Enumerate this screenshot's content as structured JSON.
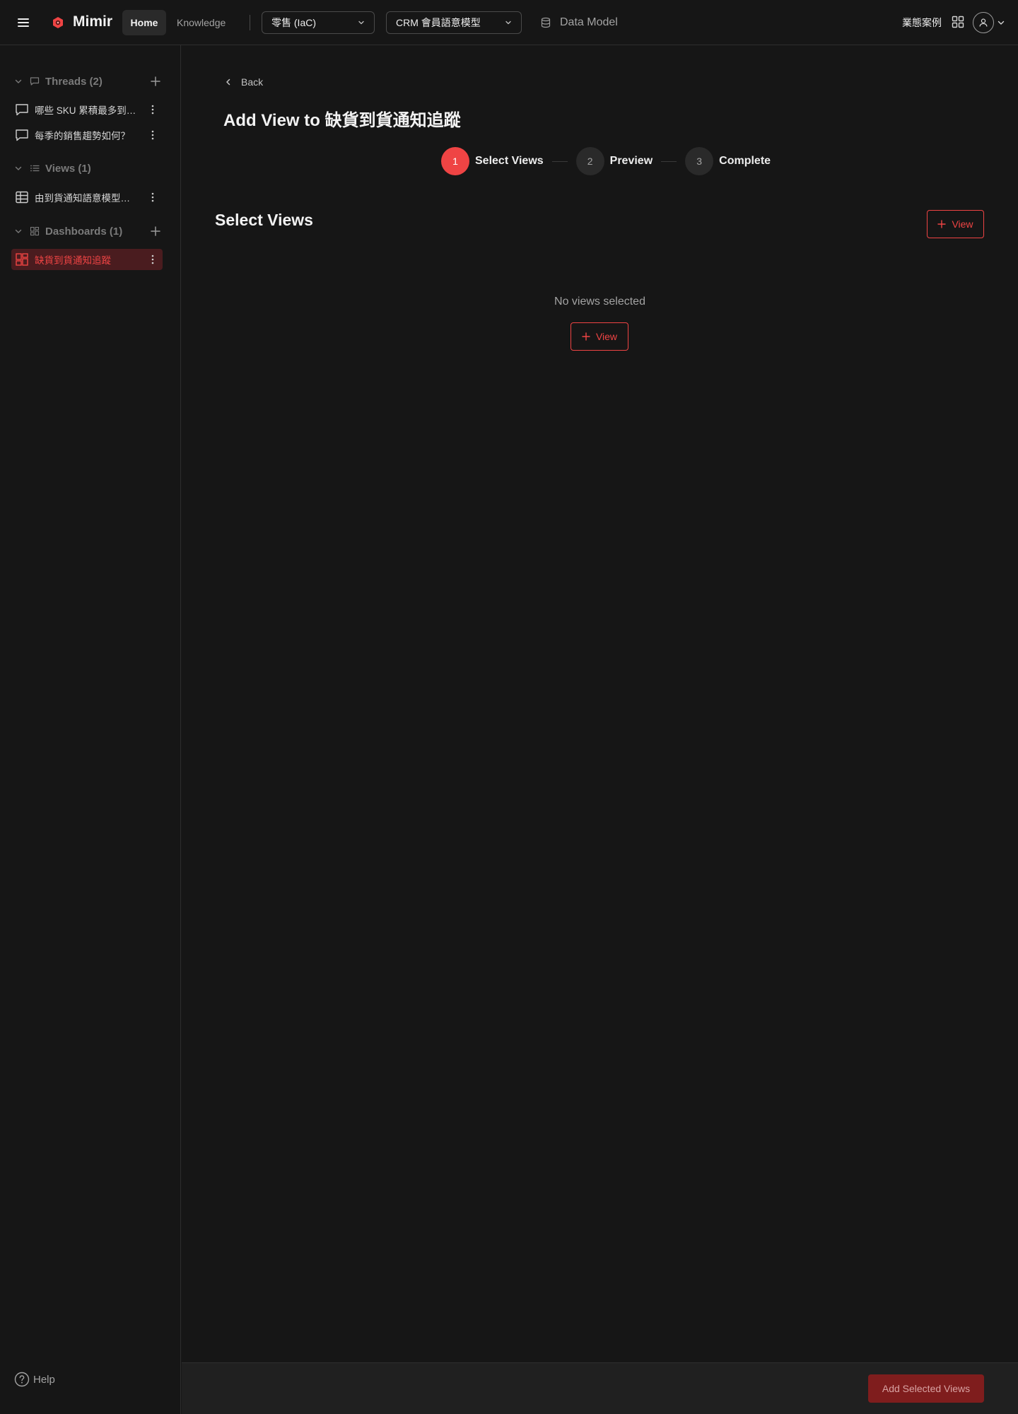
{
  "topbar": {
    "app_name": "Mimir",
    "nav_home": "Home",
    "nav_knowledge": "Knowledge",
    "domain_select": "零售 (IaC)",
    "model_select": "CRM 會員語意模型",
    "data_model": "Data Model",
    "business_cases": "業態案例"
  },
  "sidebar": {
    "threads": {
      "header": "Threads (2)",
      "items": [
        {
          "label": "哪些 SKU 累積最多到貨通知？"
        },
        {
          "label": "每季的銷售趨勢如何？"
        }
      ]
    },
    "views": {
      "header": "Views (1)",
      "items": [
        {
          "label": "由到貨通知語意模型建立的視圖"
        }
      ]
    },
    "dashboards": {
      "header": "Dashboards (1)",
      "items": [
        {
          "label": "缺貨到貨通知追蹤",
          "active": true
        }
      ]
    },
    "help": "Help"
  },
  "main": {
    "back": "Back",
    "title": "Add View to 缺貨到貨通知追蹤",
    "steps": [
      {
        "number": "1",
        "label": "Select Views",
        "status": "current"
      },
      {
        "number": "2",
        "label": "Preview",
        "status": "upcoming"
      },
      {
        "number": "3",
        "label": "Complete",
        "status": "upcoming"
      }
    ],
    "section_title": "Select Views",
    "add_view_button": "View",
    "empty_text": "No views selected",
    "empty_add_view_button": "View",
    "submit_button": "Add Selected Views"
  },
  "colors": {
    "background": "#161616",
    "accent": "#ef4444",
    "active_item_bg": "#4a1c1f",
    "disabled_button_bg": "#7f1d1d"
  }
}
